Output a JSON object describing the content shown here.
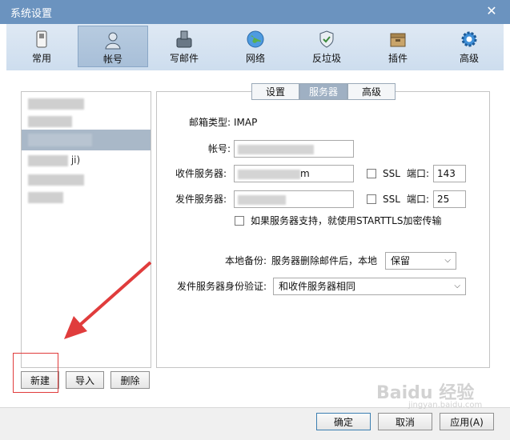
{
  "window": {
    "title": "系统设置",
    "close_glyph": "✕"
  },
  "toolbar": {
    "items": [
      {
        "label": "常用",
        "icon": "phone-icon"
      },
      {
        "label": "帐号",
        "icon": "user-icon",
        "active": true
      },
      {
        "label": "写邮件",
        "icon": "compose-icon"
      },
      {
        "label": "网络",
        "icon": "globe-icon"
      },
      {
        "label": "反垃圾",
        "icon": "shield-icon"
      },
      {
        "label": "插件",
        "icon": "plugin-box-icon"
      },
      {
        "label": "高级",
        "icon": "gear-icon"
      }
    ]
  },
  "accounts": {
    "partial_text": "ji)",
    "buttons": {
      "new": "新建",
      "import": "导入",
      "delete": "删除"
    }
  },
  "tabs": [
    "设置",
    "服务器",
    "高级"
  ],
  "server": {
    "type_label": "邮箱类型:",
    "type_value": "IMAP",
    "account_label": "帐号:",
    "incoming_label": "收件服务器:",
    "incoming_partial": "m",
    "outgoing_label": "发件服务器:",
    "ssl_label": "SSL",
    "port_label": "端口:",
    "incoming_port": "143",
    "outgoing_port": "25",
    "starttls_label": "如果服务器支持，就使用STARTTLS加密传输",
    "backup_label": "本地备份:",
    "backup_desc": "服务器删除邮件后，本地",
    "backup_value": "保留",
    "auth_label": "发件服务器身份验证:",
    "auth_value": "和收件服务器相同"
  },
  "footer": {
    "ok": "确定",
    "cancel": "取消",
    "apply": "应用(A)"
  },
  "watermark": {
    "main": "Baidu 经验",
    "sub": "jingyan.baidu.com"
  },
  "colors": {
    "titlebar": "#6b93bf",
    "toolbar_active": "#a8bfd8",
    "annotation_red": "#e03c3c"
  }
}
